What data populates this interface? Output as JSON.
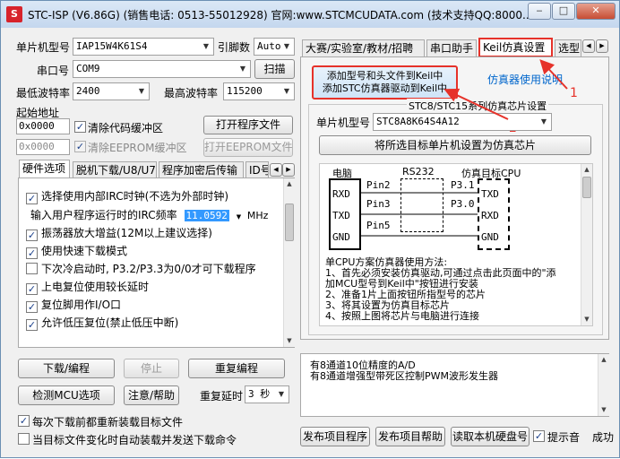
{
  "window": {
    "title": "STC-ISP (V6.86G) (销售电话: 0513-55012928) 官网:www.STCMCUDATA.com  (技术支持QQ:8000...",
    "min": "‒",
    "max": "□",
    "close": "✕"
  },
  "left": {
    "mcu_label": "单片机型号",
    "mcu_value": "IAP15W4K61S4",
    "pins_label": "引脚数",
    "pins_value": "Auto",
    "port_label": "串口号",
    "port_value": "COM9",
    "scan_button": "扫描",
    "min_baud_label": "最低波特率",
    "min_baud_value": "2400",
    "max_baud_label": "最高波特率",
    "max_baud_value": "115200",
    "start_addr_label": "起始地址",
    "addr1_value": "0x0000",
    "clear_code_label": "清除代码缓冲区",
    "open_program_button": "打开程序文件",
    "addr2_value": "0x0000",
    "clear_eeprom_label": "清除EEPROM缓冲区",
    "open_eeprom_button": "打开EEPROM文件",
    "tabs": [
      "硬件选项",
      "脱机下载/U8/U7",
      "程序加密后传输",
      "ID号"
    ],
    "options": [
      {
        "checked": true,
        "text": "选择使用内部IRC时钟(不选为外部时钟)"
      },
      {
        "checked": true,
        "text": "振荡器放大增益(12M以上建议选择)"
      },
      {
        "checked": true,
        "text": "使用快速下载模式"
      },
      {
        "checked": false,
        "text": "下次冷启动时, P3.2/P3.3为0/0才可下载程序"
      },
      {
        "checked": true,
        "text": "上电复位使用较长延时"
      },
      {
        "checked": true,
        "text": "复位脚用作I/O口"
      },
      {
        "checked": true,
        "text": "允许低压复位(禁止低压中断)"
      }
    ],
    "irc_label": "输入用户程序运行时的IRC频率",
    "irc_value": "11.0592",
    "irc_unit": "MHz",
    "download_button": "下载/编程",
    "stop_button": "停止",
    "reprogram_button": "重复编程",
    "check_mcu_button": "检测MCU选项",
    "help_button": "注意/帮助",
    "repeat_delay_label": "重复延时",
    "repeat_delay_value": "3 秒",
    "reload_label": "每次下载前都重新装载目标文件",
    "auto_send_label": "当目标文件变化时自动装载并发送下载命令"
  },
  "right": {
    "tabs": [
      "大赛/实验室/教材/招聘",
      "串口助手",
      "Keil仿真设置",
      "选型"
    ],
    "add_keil_button_line1": "添加型号和头文件到Keil中",
    "add_keil_button_line2": "添加STC仿真器驱动到Keil中",
    "emu_link": "仿真器使用说明",
    "annotation1": "1",
    "annotation2": "2",
    "group_title": "STC8/STC15系列仿真芯片设置",
    "chip_label": "单片机型号",
    "chip_value": "STC8A8K64S4A12",
    "set_chip_button": "将所选目标单片机设置为仿真芯片",
    "diagram": {
      "pc": "电脑",
      "rs232": "RS232",
      "target": "仿真目标CPU",
      "rxd": "RXD",
      "txd": "TXD",
      "gnd": "GND",
      "pin2": "Pin2",
      "pin3": "Pin3",
      "pin5": "Pin5",
      "p31": "P3.1",
      "p30": "P3.0",
      "t_txd": "TXD",
      "t_rxd": "RXD",
      "t_gnd": "GND"
    },
    "instructions": [
      "单CPU方案仿真器使用方法:",
      "1、首先必须安装仿真驱动,可通过点击此页面中的\"添",
      "加MCU型号到Keil中\"按钮进行安装",
      "2、准备1片上面按钮所指型号的芯片",
      "3、将其设置为仿真目标芯片",
      "4、按照上图将芯片与电脑进行连接"
    ],
    "info_lines": [
      "有8通道10位精度的A/D",
      "有8通道增强型带死区控制PWM波形发生器"
    ],
    "publish_program_button": "发布项目程序",
    "publish_help_button": "发布项目帮助",
    "read_disk_button": "读取本机硬盘号",
    "beep_label": "提示音",
    "status_text": "成功"
  },
  "colors": {
    "annotation": "#e6322a",
    "selection": "#3399ff",
    "link": "#0066cc"
  }
}
